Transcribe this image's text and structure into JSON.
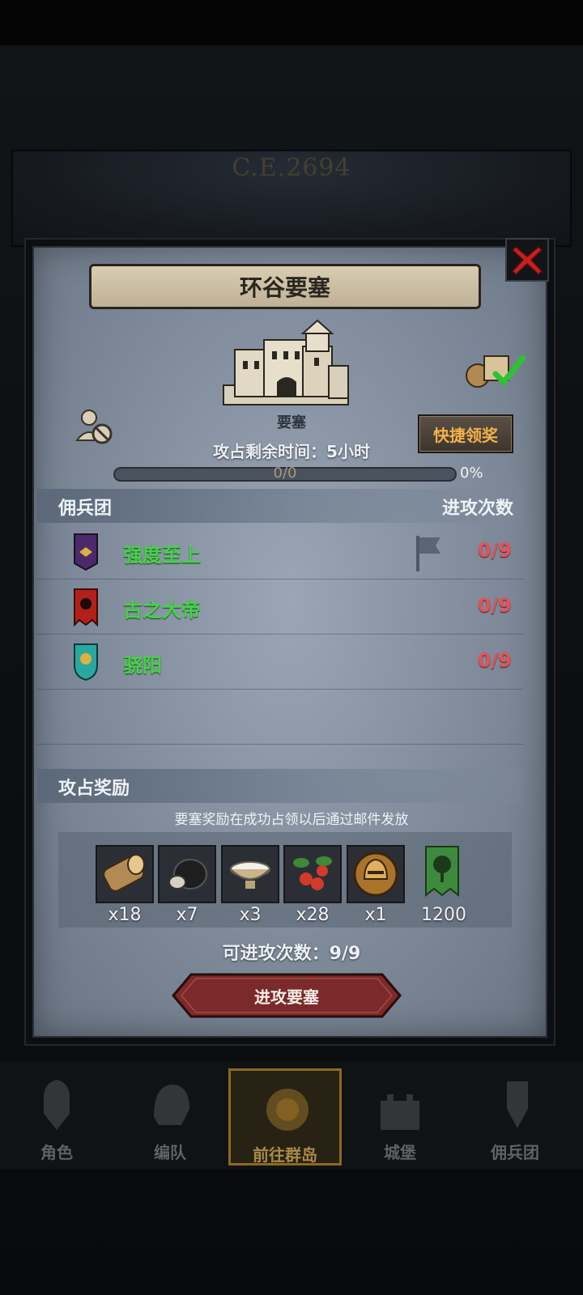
{
  "status_bar": {
    "left": "",
    "right": ""
  },
  "background": {
    "era": "C.E.2694"
  },
  "dialog": {
    "title": "环谷要塞",
    "building_label": "要塞",
    "quick_claim": "快捷领奖",
    "remaining_time": "攻占剩余时间：5小时",
    "progress": {
      "text": "0/0",
      "percent": "0%",
      "fraction": 0
    },
    "mercenary_header": "佣兵团",
    "attacks_header": "进攻次数",
    "mercenaries": [
      {
        "name": "强度至上",
        "count": "0/9",
        "banner_color": "#4a2a6a",
        "icon": "eagle-banner-icon"
      },
      {
        "name": "古之大帝",
        "count": "0/9",
        "banner_color": "#b2201c",
        "icon": "sun-banner-icon"
      },
      {
        "name": "骁阳",
        "count": "0/9",
        "banner_color": "#2aa8a0",
        "icon": "sun-shield-icon"
      }
    ],
    "rewards_header": "攻占奖励",
    "rewards_note": "要塞奖励在成功占领以后通过邮件发放",
    "rewards": [
      {
        "icon": "wood-log-icon",
        "qty": "x18"
      },
      {
        "icon": "truffle-icon",
        "qty": "x7"
      },
      {
        "icon": "salt-bowl-icon",
        "qty": "x3"
      },
      {
        "icon": "berries-icon",
        "qty": "x28"
      },
      {
        "icon": "helmet-medal-icon",
        "qty": "x1"
      },
      {
        "icon": "tree-banner-icon",
        "qty": "1200"
      }
    ],
    "attack_count": "可进攻次数：9/9",
    "attack_button": "进攻要塞"
  },
  "nav": [
    {
      "label": "角色",
      "icon": "knight-icon"
    },
    {
      "label": "编队",
      "icon": "helmet-icon"
    },
    {
      "label": "前往群岛",
      "icon": "compass-icon",
      "active": true
    },
    {
      "label": "城堡",
      "icon": "castle-icon"
    },
    {
      "label": "佣兵团",
      "icon": "mercenary-icon"
    }
  ],
  "colors": {
    "name_green": "#46d24a",
    "count_red": "#e2535a",
    "quick_claim_text": "#f3b24a",
    "attack_button": "#7a2a2a"
  }
}
